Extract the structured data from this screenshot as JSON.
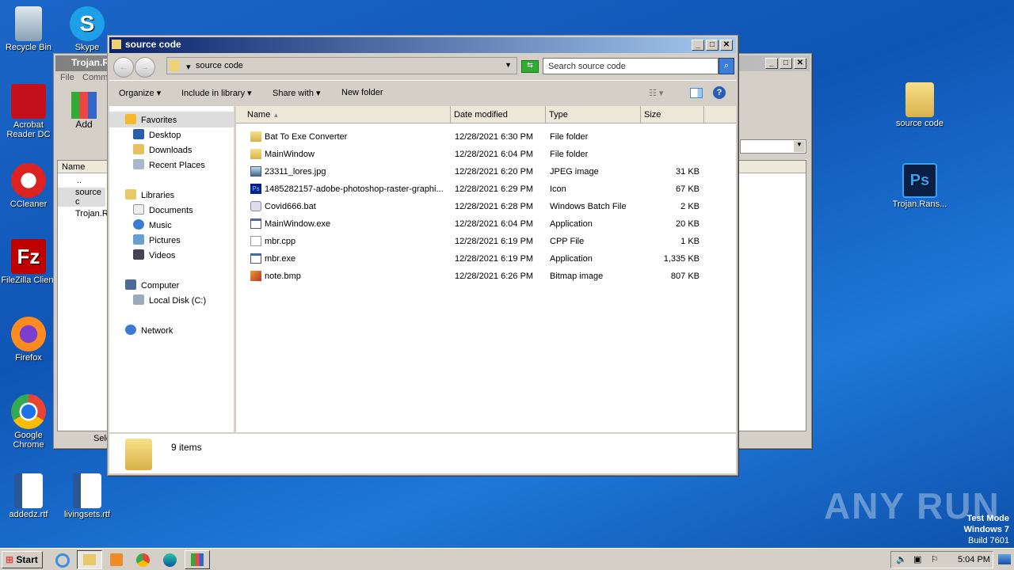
{
  "desktop": {
    "left_icons": [
      "Recycle Bin",
      "Skype",
      "Acrobat Reader DC",
      "CCleaner",
      "FileZilla Client",
      "Firefox",
      "Google Chrome",
      "addedz.rtf",
      "livingsets.rtf"
    ],
    "right_icons": [
      "source code",
      "Trojan.Rans..."
    ],
    "watermark": "ANY RUN",
    "test_mode": [
      "Test Mode",
      "Windows 7",
      "Build 7601"
    ]
  },
  "winrar": {
    "title": "Trojan.R",
    "menu": [
      "File",
      "Comm"
    ],
    "add_label": "Add",
    "col_name": "Name",
    "rows": [
      "..",
      "source c",
      "Trojan.R"
    ],
    "status": "Sele"
  },
  "explorer": {
    "title": "source code",
    "address": "source code",
    "search_placeholder": "Search source code",
    "toolbar": {
      "organize": "Organize",
      "include": "Include in library",
      "share": "Share with",
      "new_folder": "New folder"
    },
    "nav": {
      "favorites": "Favorites",
      "fav_items": [
        "Desktop",
        "Downloads",
        "Recent Places"
      ],
      "libraries": "Libraries",
      "lib_items": [
        "Documents",
        "Music",
        "Pictures",
        "Videos"
      ],
      "computer": "Computer",
      "comp_items": [
        "Local Disk (C:)"
      ],
      "network": "Network"
    },
    "columns": [
      "Name",
      "Date modified",
      "Type",
      "Size"
    ],
    "files": [
      {
        "name": "Bat To Exe Converter",
        "date": "12/28/2021 6:30 PM",
        "type": "File folder",
        "size": "",
        "icon": "folder"
      },
      {
        "name": "MainWindow",
        "date": "12/28/2021 6:04 PM",
        "type": "File folder",
        "size": "",
        "icon": "folder"
      },
      {
        "name": "23311_lores.jpg",
        "date": "12/28/2021 6:20 PM",
        "type": "JPEG image",
        "size": "31 KB",
        "icon": "image"
      },
      {
        "name": "1485282157-adobe-photoshop-raster-graphi...",
        "date": "12/28/2021 6:29 PM",
        "type": "Icon",
        "size": "67 KB",
        "icon": "ps"
      },
      {
        "name": "Covid666.bat",
        "date": "12/28/2021 6:28 PM",
        "type": "Windows Batch File",
        "size": "2 KB",
        "icon": "gear"
      },
      {
        "name": "MainWindow.exe",
        "date": "12/28/2021 6:04 PM",
        "type": "Application",
        "size": "20 KB",
        "icon": "app"
      },
      {
        "name": "mbr.cpp",
        "date": "12/28/2021 6:19 PM",
        "type": "CPP File",
        "size": "1 KB",
        "icon": "file"
      },
      {
        "name": "mbr.exe",
        "date": "12/28/2021 6:19 PM",
        "type": "Application",
        "size": "1,335 KB",
        "icon": "app"
      },
      {
        "name": "note.bmp",
        "date": "12/28/2021 6:26 PM",
        "type": "Bitmap image",
        "size": "807 KB",
        "icon": "bmp"
      }
    ],
    "status": "9 items"
  },
  "taskbar": {
    "start": "Start",
    "clock": "5:04 PM"
  }
}
